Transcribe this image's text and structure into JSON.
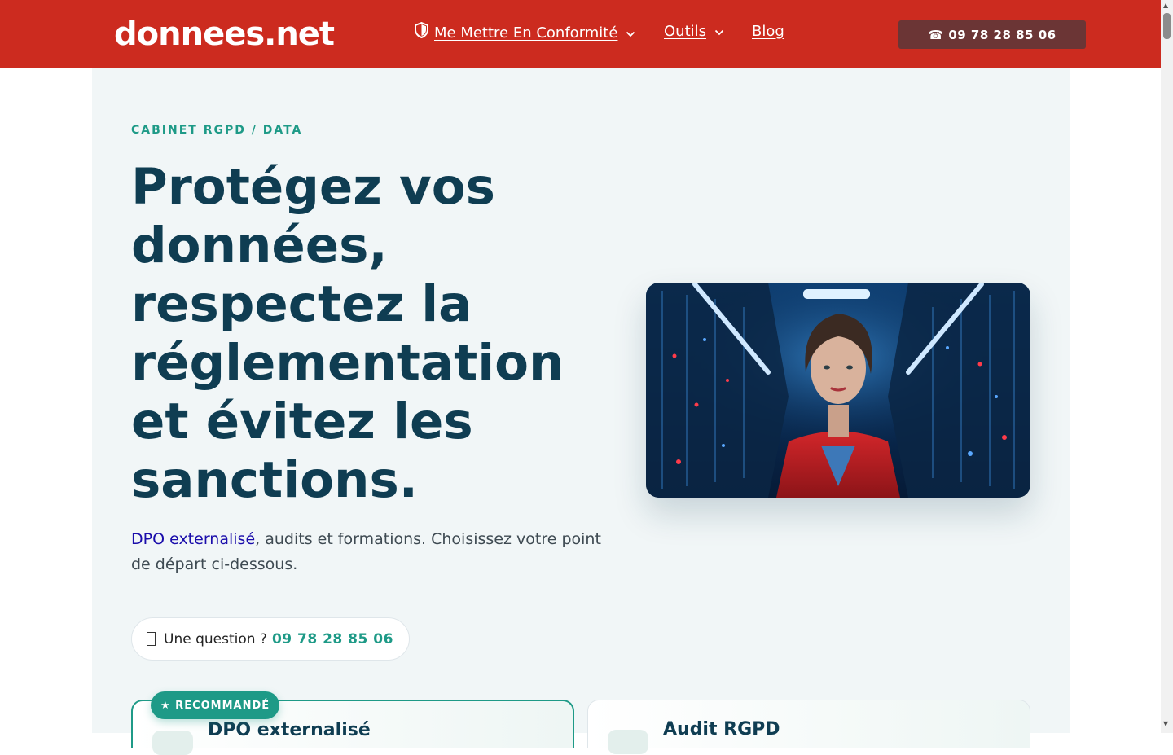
{
  "header": {
    "logo_text": "donnees.net",
    "nav": [
      {
        "label": "Me Mettre En Conformité",
        "icon": "shield-icon",
        "has_dropdown": true
      },
      {
        "label": "Outils",
        "has_dropdown": true
      },
      {
        "label": "Blog",
        "has_dropdown": false
      }
    ],
    "phone_button_label": "☎ 09 78 28 85 06",
    "background_color": "#cc2b1f"
  },
  "hero": {
    "eyebrow": "CABINET RGPD / DATA",
    "headline": "Protégez vos données, respectez la réglementation et évitez les sanctions.",
    "subtext_link": "DPO externalisé",
    "subtext_rest": ", audits et formations. Choisissez votre point de départ ci-dessous.",
    "question_label": "Une question ?",
    "question_phone": "09 78 28 85 06",
    "image_alt": "Woman in red jacket standing in a server room"
  },
  "cards": [
    {
      "badge": "★ RECOMMANDÉ",
      "title": "DPO externalisé"
    },
    {
      "title": "Audit RGPD"
    }
  ],
  "colors": {
    "brand_red": "#cc2b1f",
    "accent_teal": "#1e9a87",
    "headline_navy": "#0f3d52",
    "phone_button_bg": "#6b3535"
  }
}
